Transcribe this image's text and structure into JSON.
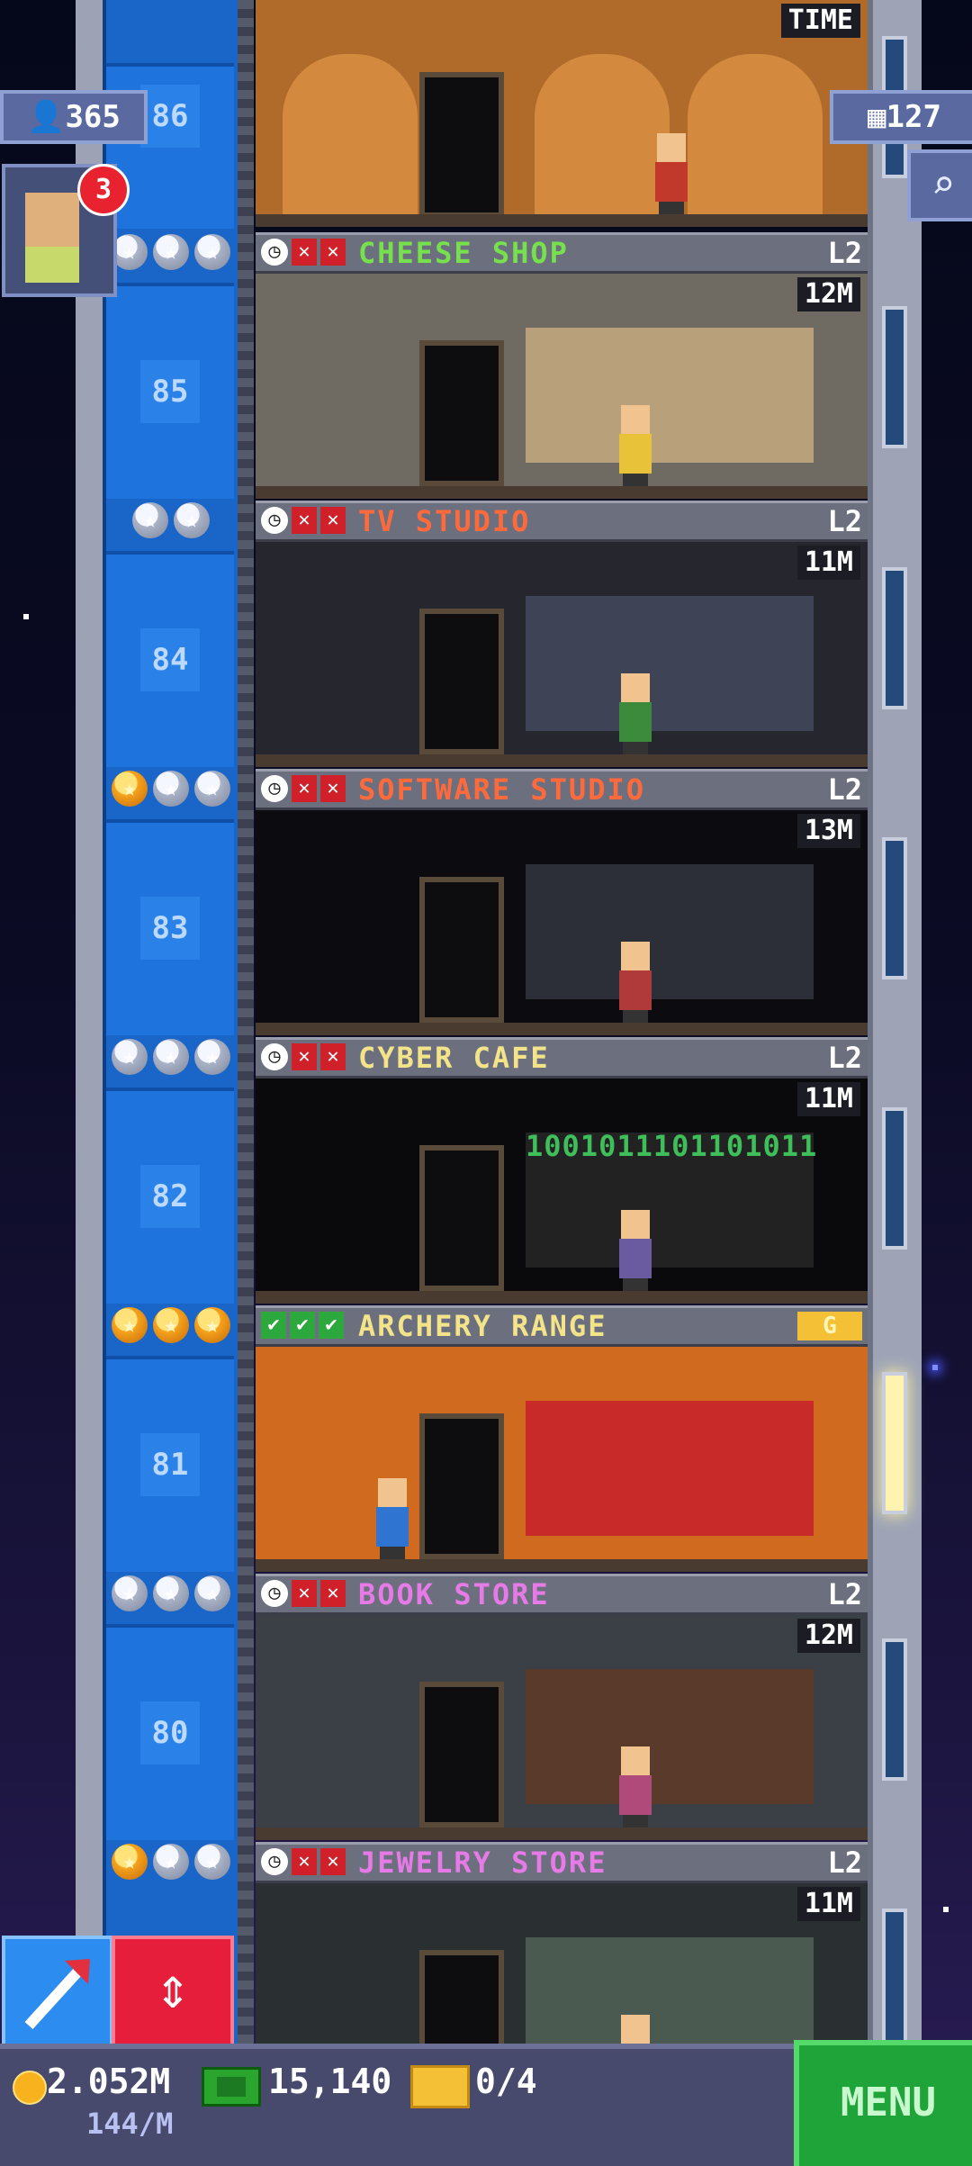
{
  "hud": {
    "population": "365",
    "floors": "127",
    "vip_count": "3",
    "top_timer": "TIME"
  },
  "floors": [
    {
      "number": "86",
      "name": "CHEESE SHOP",
      "name_color": "#76e04d",
      "level": "L2",
      "timer": "12M",
      "stars": [
        "silver",
        "silver",
        "silver"
      ],
      "status": [
        "clock",
        "x",
        "x"
      ]
    },
    {
      "number": "85",
      "name": "TV STUDIO",
      "name_color": "#ff6a3d",
      "level": "L2",
      "timer": "11M",
      "stars": [
        "silver",
        "silver"
      ],
      "status": [
        "clock",
        "x",
        "x"
      ]
    },
    {
      "number": "84",
      "name": "SOFTWARE STUDIO",
      "name_color": "#ff6a3d",
      "level": "L2",
      "timer": "13M",
      "stars": [
        "gold",
        "silver",
        "silver"
      ],
      "status": [
        "clock",
        "x",
        "x"
      ]
    },
    {
      "number": "83",
      "name": "CYBER CAFE",
      "name_color": "#f3e48a",
      "level": "L2",
      "timer": "11M",
      "stars": [
        "silver",
        "silver",
        "silver"
      ],
      "status": [
        "clock",
        "x",
        "x"
      ]
    },
    {
      "number": "82",
      "name": "ARCHERY RANGE",
      "name_color": "#f3e48a",
      "level": "G",
      "timer": "",
      "stars": [
        "gold",
        "gold",
        "gold"
      ],
      "status": [
        "ok",
        "ok",
        "ok"
      ]
    },
    {
      "number": "81",
      "name": "BOOK STORE",
      "name_color": "#e67ae6",
      "level": "L2",
      "timer": "12M",
      "stars": [
        "silver",
        "silver",
        "silver"
      ],
      "status": [
        "clock",
        "x",
        "x"
      ]
    },
    {
      "number": "80",
      "name": "JEWELRY STORE",
      "name_color": "#e67ae6",
      "level": "L2",
      "timer": "11M",
      "stars": [
        "gold",
        "silver",
        "silver"
      ],
      "status": [
        "clock",
        "x",
        "x"
      ]
    }
  ],
  "room_texts": {
    "binary": "1001011101101011"
  },
  "bottom_bar": {
    "coins": "2.052M",
    "coin_rate": "144/M",
    "bux": "15,140",
    "tickets": "0/4",
    "menu_label": "MENU"
  },
  "colors": {
    "shaft": "#1a66c8",
    "menu": "#1fa43a",
    "elevator_button": "#e61e3c"
  }
}
